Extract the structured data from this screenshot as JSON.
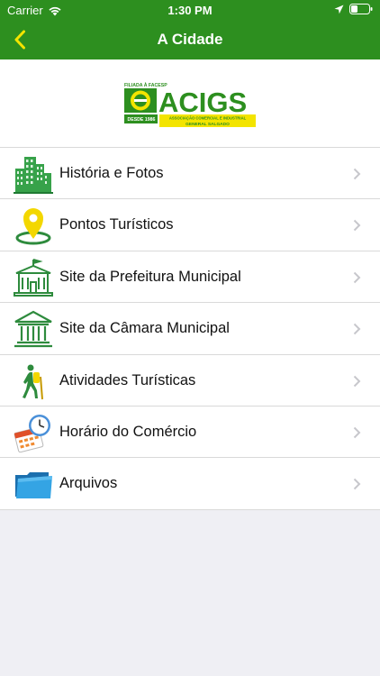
{
  "status_bar": {
    "carrier": "Carrier",
    "time": "1:30 PM"
  },
  "nav": {
    "title": "A Cidade",
    "back_icon": "chevron-left-icon"
  },
  "logo": {
    "name": "ACIGS",
    "tagline_top": "FILIADA À FACESP",
    "since": "DESDE 1986",
    "subtitle_1": "ASSOCIAÇÃO COMERCIAL E INDUSTRIAL",
    "subtitle_2": "GENERAL SALGADO"
  },
  "menu": {
    "items": [
      {
        "label": "História e Fotos",
        "icon": "city-buildings-icon"
      },
      {
        "label": "Pontos Turísticos",
        "icon": "map-pin-icon"
      },
      {
        "label": "Site da Prefeitura Municipal",
        "icon": "city-hall-icon"
      },
      {
        "label": "Site da Câmara Municipal",
        "icon": "columns-building-icon"
      },
      {
        "label": "Atividades Turísticas",
        "icon": "hiker-icon"
      },
      {
        "label": "Horário do Comércio",
        "icon": "clock-calendar-icon"
      },
      {
        "label": "Arquivos",
        "icon": "folder-icon"
      }
    ]
  },
  "colors": {
    "brand_green": "#2d8f1f",
    "accent_yellow": "#f3e400"
  }
}
